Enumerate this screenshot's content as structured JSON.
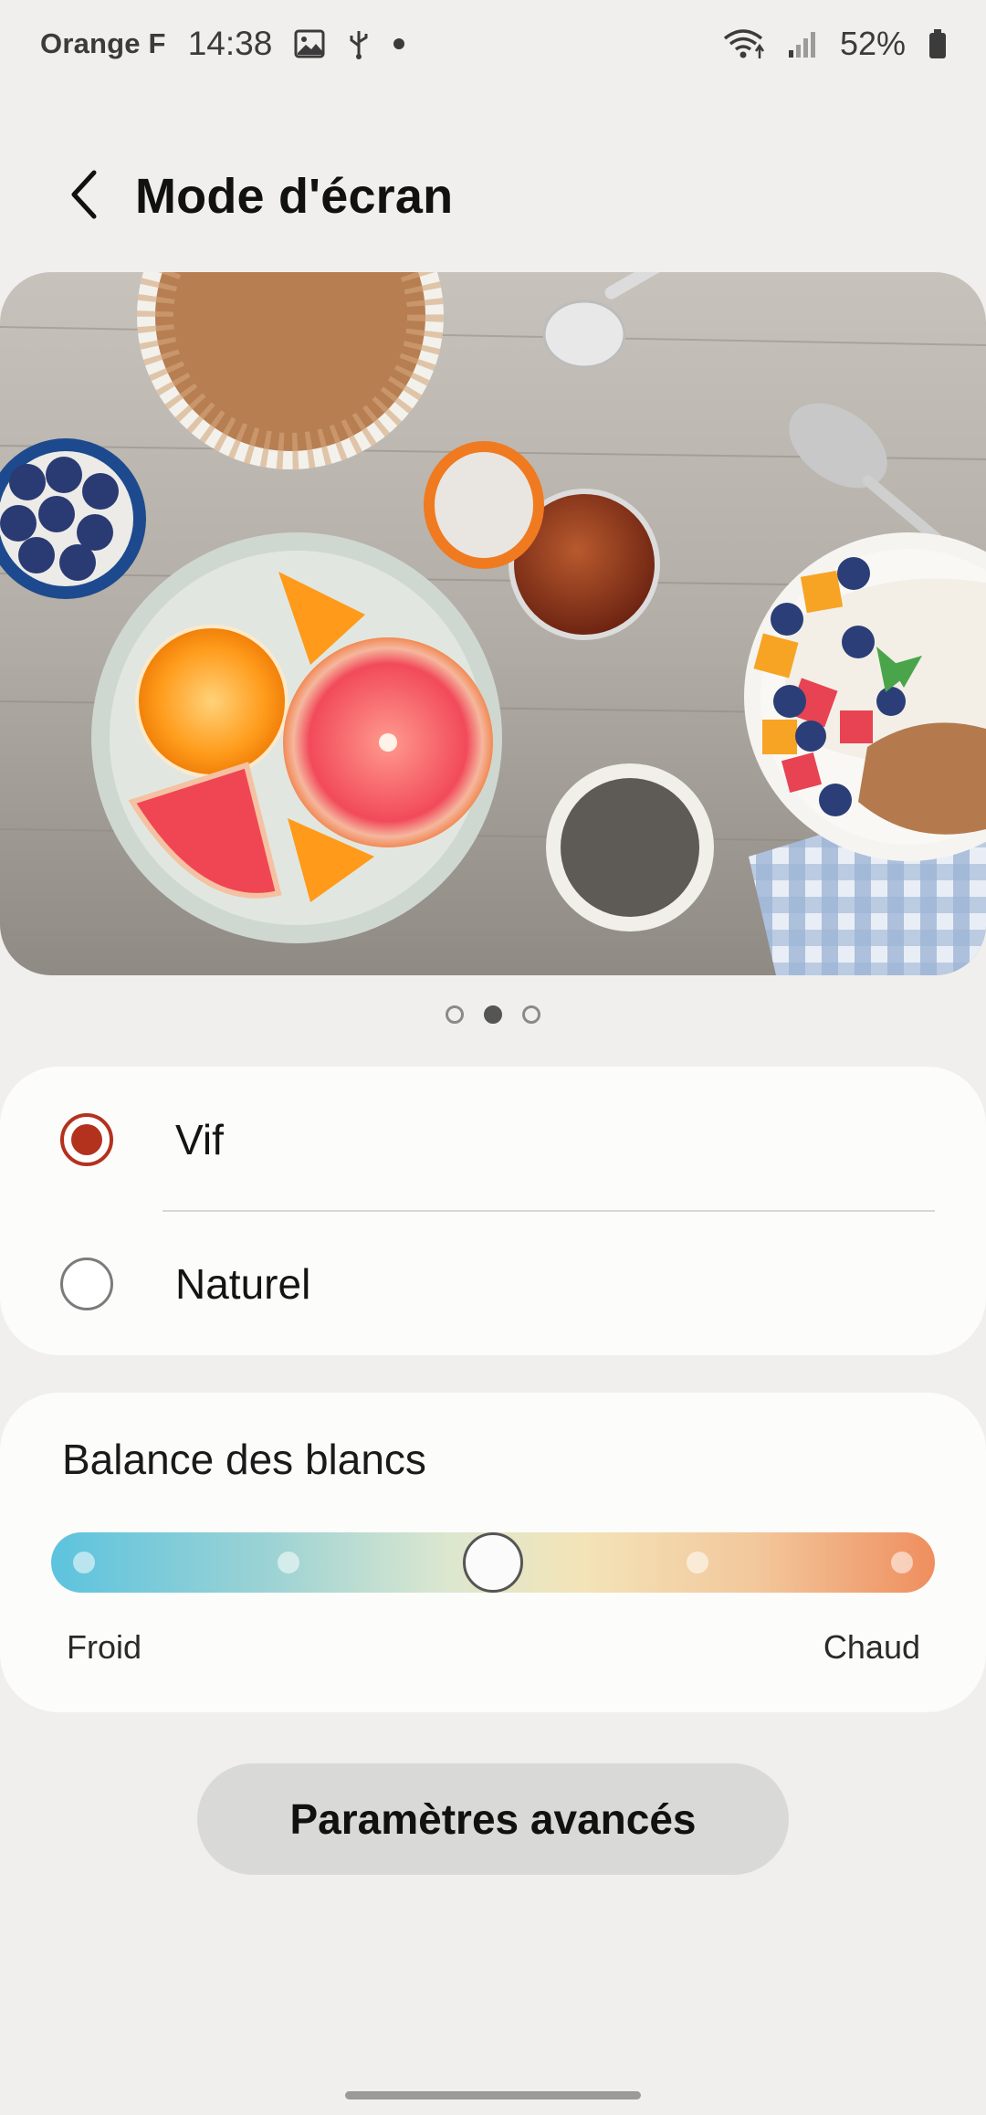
{
  "status_bar": {
    "carrier": "Orange F",
    "time": "14:38",
    "battery": "52%",
    "icons": [
      "gallery-icon",
      "usb-icon",
      "notification-dot-icon",
      "wifi-icon",
      "signal-icon",
      "battery-icon"
    ]
  },
  "header": {
    "title": "Mode d'écran",
    "back_icon": "back-arrow-icon"
  },
  "preview": {
    "page_count": 3,
    "active_page": 2,
    "pages": [
      "",
      "",
      ""
    ]
  },
  "screen_mode": {
    "selected": "Vif",
    "options": [
      {
        "label": "Vif",
        "checked": true
      },
      {
        "label": "Naturel",
        "checked": false
      }
    ]
  },
  "white_balance": {
    "title": "Balance des blancs",
    "cold_label": "Froid",
    "warm_label": "Chaud",
    "steps": 5,
    "value_step": 3,
    "colors": {
      "cold": "#5cc3de",
      "neutral": "#f3e4b8",
      "warm": "#ef8e5e"
    }
  },
  "advanced_button": {
    "label": "Paramètres avancés"
  },
  "colors": {
    "background": "#f0efed",
    "card": "#fcfcfb",
    "accent": "#b3321e",
    "button": "#d9d9d8"
  }
}
